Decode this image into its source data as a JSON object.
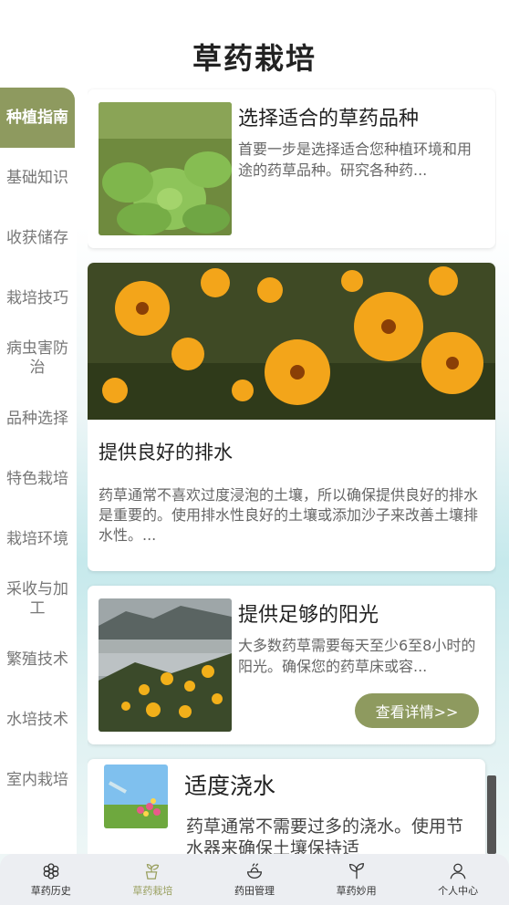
{
  "header": {
    "title": "草药栽培"
  },
  "sidebar": {
    "items": [
      {
        "label": "种植指南"
      },
      {
        "label": "基础知识"
      },
      {
        "label": "收获储存"
      },
      {
        "label": "栽培技巧"
      },
      {
        "label": "病虫害防治"
      },
      {
        "label": "品种选择"
      },
      {
        "label": "特色栽培"
      },
      {
        "label": "栽培环境"
      },
      {
        "label": "采收与加工"
      },
      {
        "label": "繁殖技术"
      },
      {
        "label": "水培技术"
      },
      {
        "label": "室内栽培"
      }
    ]
  },
  "cards": [
    {
      "title": "选择适合的草药品种",
      "desc": "首要一步是选择适合您种植环境和用途的药草品种。研究各种药..."
    },
    {
      "title": "提供良好的排水",
      "desc": "药草通常不喜欢过度浸泡的土壤，所以确保提供良好的排水是重要的。使用排水性良好的土壤或添加沙子来改善土壤排水性。..."
    },
    {
      "title": "提供足够的阳光",
      "desc": "大多数药草需要每天至少6至8小时的阳光。确保您的药草床或容...",
      "button": "查看详情>>"
    },
    {
      "title": "适度浇水",
      "desc": "药草通常不需要过多的浇水。使用节水器来确保土壤保持适"
    }
  ],
  "tabbar": {
    "items": [
      {
        "label": "草药历史",
        "icon": "flower-icon"
      },
      {
        "label": "草药栽培",
        "icon": "pot-plant-icon"
      },
      {
        "label": "药田管理",
        "icon": "bowl-icon"
      },
      {
        "label": "草药妙用",
        "icon": "sprout-icon"
      },
      {
        "label": "个人中心",
        "icon": "user-icon"
      }
    ],
    "active_color": "#9aa060"
  },
  "colors": {
    "accent": "#8e9a5f"
  }
}
